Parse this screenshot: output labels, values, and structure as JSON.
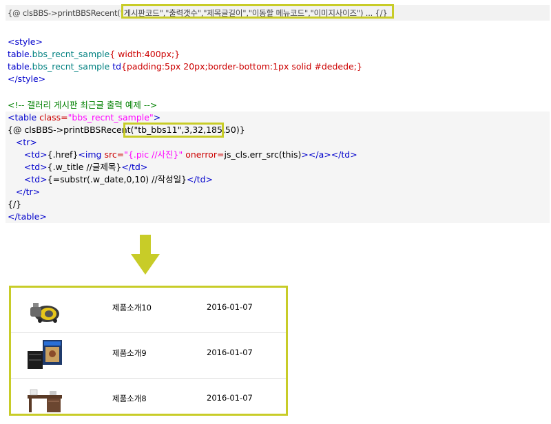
{
  "syntax": {
    "prefix": "{@ clsBBS->printBBSRecent(",
    "params": "\"게시판코드\",\"출력갯수\",\"제목글길이\",\"이동할 메뉴코드\",\"이미지사이즈\"",
    "suffix": ") ... {/}"
  },
  "css_block": {
    "open": "<style>",
    "line1_sel": "table.",
    "line1_cls": "bbs_recnt_sample",
    "line1_rest": "{ width:400px;}",
    "line2_sel": "table.",
    "line2_cls": "bbs_recnt_sample",
    "line2_td": " td",
    "line2_rest": "{padding:5px 20px;border-bottom:1px solid #dedede;}",
    "close": "</style>"
  },
  "code_block": {
    "comment": "<!-- 갤러리 게시판 최근글 출력 예제 -->",
    "table_open_tag": "<table ",
    "table_class_attr": "class=",
    "table_class_val": "\"bbs_recnt_sample\"",
    "table_open_end": ">",
    "call_prefix": "{@ clsBBS->printBBSRecent(",
    "call_args": "\"tb_bbs11\",3,32,185,50",
    "call_suffix": ")}",
    "tr_open": "<tr>",
    "line_td1_a": "<td>",
    "line_td1_b": "{.href}",
    "line_td1_c": "<img ",
    "line_td1_d": "src=",
    "line_td1_e": "\"{.pic //사진}\"",
    "line_td1_f": " onerror=",
    "line_td1_g": "js_cls.err_src(this)",
    "line_td1_h": "></a></td>",
    "line_td2_a": "<td>",
    "line_td2_b": "{.w_title //글제목}",
    "line_td2_c": "</td>",
    "line_td3_a": "<td>",
    "line_td3_b": "{=substr(.w_date,0,10) //작성일}",
    "line_td3_c": "</td>",
    "tr_close": "</tr>",
    "loop_close": "{/}",
    "table_close": "</table>"
  },
  "colors": {
    "highlight_border": "#c8cc28",
    "arrow": "#c8cc28",
    "separator": "#dedede"
  },
  "demo": {
    "rows": [
      {
        "image_icon": "vacuum-cleaner-image",
        "title": "제품소개10",
        "date": "2016-01-07"
      },
      {
        "image_icon": "game-console-image",
        "title": "제품소개9",
        "date": "2016-01-07"
      },
      {
        "image_icon": "desk-furniture-image",
        "title": "제품소개8",
        "date": "2016-01-07"
      }
    ]
  }
}
